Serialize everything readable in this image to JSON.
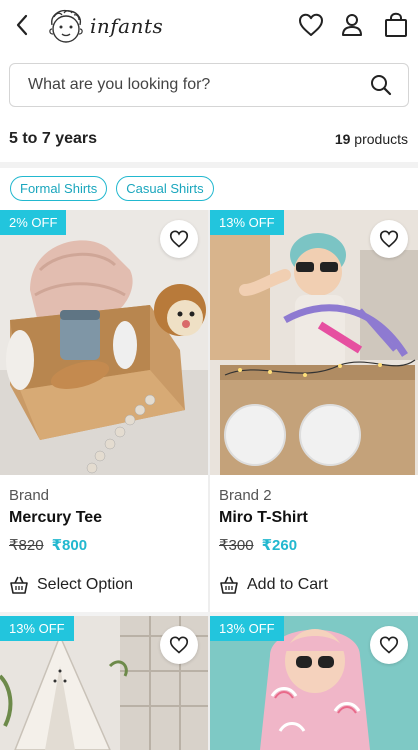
{
  "header": {
    "logo_text": "infants"
  },
  "search": {
    "placeholder": "What are you looking for?"
  },
  "results": {
    "age_label": "5 to 7 years",
    "count": "19",
    "count_suffix": " products"
  },
  "filters": [
    "Formal Shirts",
    "Casual Shirts"
  ],
  "colors": {
    "accent": "#22b8cf",
    "badge": "#22c5dd"
  },
  "products": [
    {
      "badge": "2% OFF",
      "brand": "Brand",
      "name": "Mercury Tee",
      "old_price": "₹820",
      "new_price": "₹800",
      "action": "Select Option"
    },
    {
      "badge": "13% OFF",
      "brand": "Brand 2",
      "name": "Miro T-Shirt",
      "old_price": "₹300",
      "new_price": "₹260",
      "action": "Add to Cart"
    },
    {
      "badge": "13% OFF"
    },
    {
      "badge": "13% OFF"
    }
  ]
}
